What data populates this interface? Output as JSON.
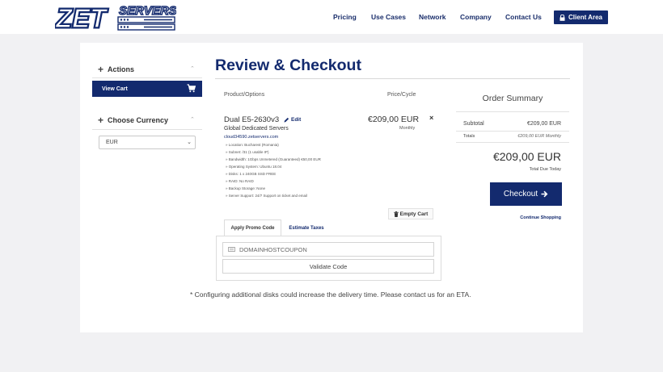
{
  "brand": {
    "logo_text_main": "ZET",
    "logo_text_sub": "SERVERS"
  },
  "nav": {
    "items": [
      {
        "label": "Pricing"
      },
      {
        "label": "Use Cases"
      },
      {
        "label": "Network"
      },
      {
        "label": "Company"
      },
      {
        "label": "Contact Us"
      }
    ],
    "client_area_label": "Client Area"
  },
  "sidebar": {
    "actions_label": "Actions",
    "view_cart_label": "View Cart",
    "currency_label": "Choose Currency",
    "currency_value": "EUR"
  },
  "page": {
    "title": "Review & Checkout",
    "col_product": "Product/Options",
    "col_price": "Price/Cycle"
  },
  "cart_item": {
    "name": "Dual E5-2630v3",
    "edit_label": "Edit",
    "group": "Global Dedicated Servers",
    "domain": "cloud34590.zetservers.com",
    "config": [
      "» Location: Bucharest (Romania)",
      "» Subnet: /31 (1 usable IP)",
      "» Bandwidth: 1Gbps Unmetered (Guaranteed) €50,00 EUR",
      "» Operating System: Ubuntu 18.04",
      "» Disks: 1 x 240GB SSD FREE",
      "» RAID: No RAID",
      "» Backup Storage: None",
      "» Server Support: 24/7 Support on ticket and email"
    ],
    "price": "€209,00 EUR",
    "cycle": "Monthly",
    "remove_symbol": "×"
  },
  "empty_cart_label": "Empty Cart",
  "promo": {
    "tab_promo": "Apply Promo Code",
    "tab_taxes": "Estimate Taxes",
    "placeholder": "DOMAINHOSTCOUPON",
    "validate_label": "Validate Code"
  },
  "note": "* Configuring additional disks could increase the delivery time. Please contact us for an ETA.",
  "summary": {
    "title": "Order Summary",
    "subtotal_label": "Subtotal",
    "subtotal_value": "€209,00 EUR",
    "totals_label": "Totals",
    "totals_value": "€209,00 EUR Monthly",
    "total_amount": "€209,00 EUR",
    "total_due_label": "Total Due Today",
    "checkout_label": "Checkout",
    "continue_label": "Continue Shopping"
  },
  "colors": {
    "brand": "#132a6e",
    "background": "#f1f1f3"
  }
}
